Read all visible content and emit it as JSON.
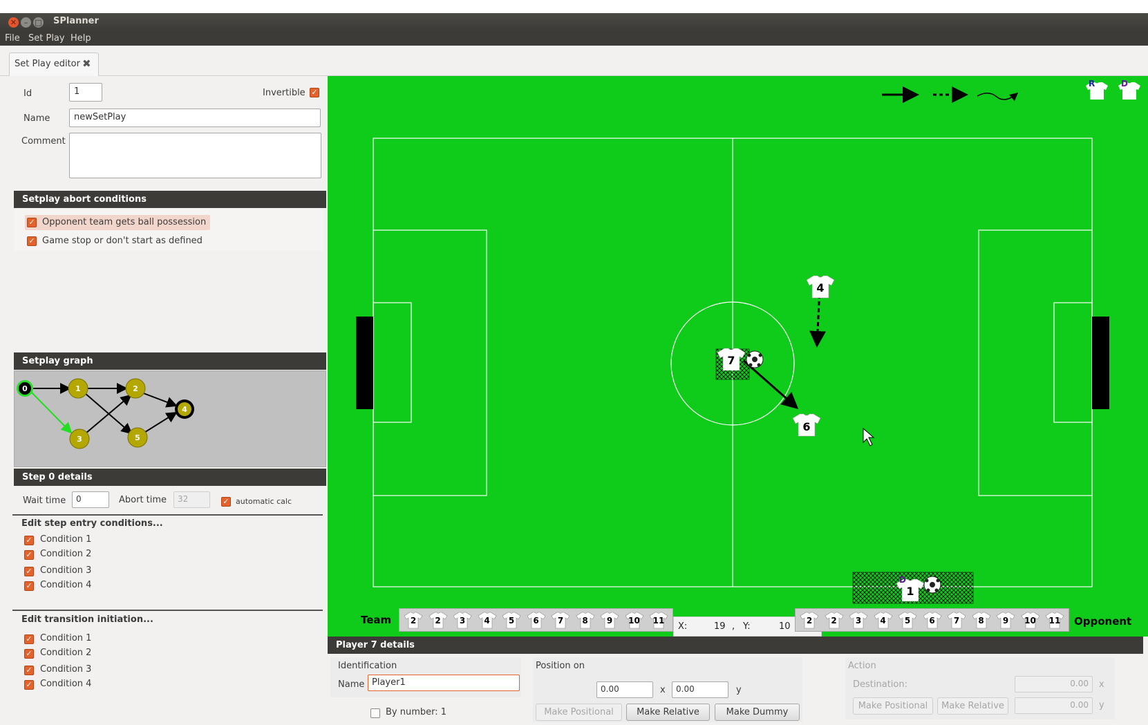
{
  "window": {
    "title": "SPlanner"
  },
  "menu": [
    "File",
    "Set Play",
    "Help"
  ],
  "tab": {
    "label": "Set Play editor"
  },
  "form": {
    "id_label": "Id",
    "id_value": "1",
    "invertible_label": "Invertible",
    "name_label": "Name",
    "name_value": "newSetPlay",
    "comment_label": "Comment",
    "comment_value": ""
  },
  "abort": {
    "header": "Setplay abort conditions",
    "items": [
      "Opponent team gets ball possession",
      "Game stop or don't start as defined"
    ]
  },
  "graph": {
    "header": "Setplay graph",
    "nodes": [
      {
        "label": "0",
        "kind": "start"
      },
      {
        "label": "1",
        "kind": "step"
      },
      {
        "label": "2",
        "kind": "step"
      },
      {
        "label": "3",
        "kind": "step"
      },
      {
        "label": "4",
        "kind": "end"
      },
      {
        "label": "5",
        "kind": "step"
      }
    ]
  },
  "step": {
    "header": "Step 0 details",
    "wait_label": "Wait time",
    "wait_value": "0",
    "abort_label": "Abort time",
    "abort_value": "32",
    "auto_label": "automatic calc"
  },
  "entry": {
    "title": "Edit step entry conditions...",
    "items": [
      "Condition 1",
      "Condition 2",
      "Condition 3",
      "Condition 4"
    ]
  },
  "transition": {
    "title": "Edit transition initiation...",
    "items": [
      "Condition 1",
      "Condition 2",
      "Condition 3",
      "Condition 4"
    ]
  },
  "field": {
    "corner_labels": [
      "R",
      "D"
    ],
    "players": [
      {
        "number": "4",
        "role": "teammate"
      },
      {
        "number": "7",
        "role": "selected-with-ball"
      },
      {
        "number": "6",
        "role": "teammate"
      },
      {
        "number": "1",
        "role": "dummy-with-ball",
        "badge": "D"
      }
    ],
    "team_label": "Team",
    "opponent_label": "Opponent",
    "team_shirts": [
      "2",
      "2",
      "3",
      "4",
      "5",
      "6",
      "7",
      "8",
      "9",
      "10",
      "11"
    ],
    "opponent_shirts": [
      "2",
      "2",
      "3",
      "4",
      "5",
      "6",
      "7",
      "8",
      "9",
      "10",
      "11"
    ],
    "coords": {
      "x_label": "X:",
      "x_value": "19",
      "sep": ",",
      "y_label": "Y:",
      "y_value": "10"
    }
  },
  "player_details": {
    "header": "Player 7 details",
    "identification_label": "Identification",
    "name_label": "Name",
    "name_value": "Player1",
    "by_number_label": "By number: 1",
    "position_label": "Position on",
    "pos_x": "0.00",
    "pos_sep": "x",
    "pos_y": "0.00",
    "pos_y_label": "y",
    "buttons": [
      "Make Positional",
      "Make Relative",
      "Make Dummy"
    ],
    "action_label": "Action",
    "destination_label": "Destination:",
    "dest_x": "0.00",
    "dest_x_label": "x",
    "dest_y": "0.00",
    "dest_y_label": "y",
    "action_buttons": [
      "Make Positional",
      "Make Relative"
    ]
  },
  "colors": {
    "field": "#0fcb1a",
    "accent": "#e4622c",
    "header": "#3c3b37"
  }
}
